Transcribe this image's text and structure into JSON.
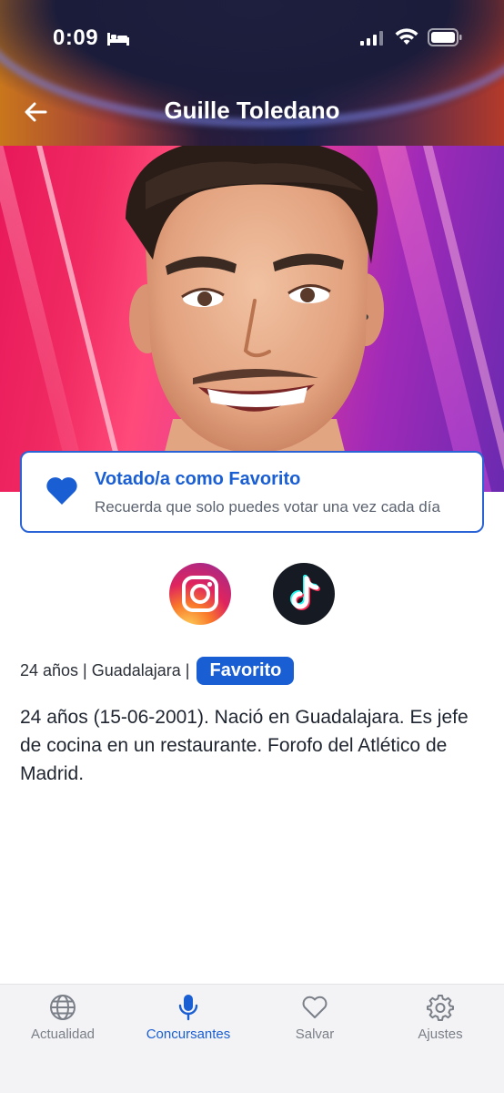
{
  "status_bar": {
    "time": "0:09",
    "icons": [
      "bed-icon",
      "signal-icon",
      "wifi-icon",
      "battery-icon"
    ]
  },
  "header": {
    "title": "Guille Toledano",
    "back_icon": "back-arrow-icon"
  },
  "vote_card": {
    "title": "Votado/a como Favorito",
    "subtitle": "Recuerda que solo puedes votar una vez cada día",
    "icon": "heart-fill-icon"
  },
  "social": {
    "links": [
      "instagram",
      "tiktok"
    ]
  },
  "info": {
    "text": "24 años | Guadalajara |",
    "badge": "Favorito"
  },
  "bio": "24 años (15-06-2001). Nació en Guadalajara. Es jefe de cocina en un restaurante. Forofo del Atlético de Madrid.",
  "tabs": [
    {
      "label": "Actualidad",
      "icon": "globe-icon",
      "active": false
    },
    {
      "label": "Concursantes",
      "icon": "microphone-icon",
      "active": true
    },
    {
      "label": "Salvar",
      "icon": "heart-outline-icon",
      "active": false
    },
    {
      "label": "Ajustes",
      "icon": "gear-icon",
      "active": false
    }
  ],
  "colors": {
    "accent": "#1a5ed4",
    "inactive_tab": "#7a7f88",
    "tabbar_bg": "#f3f3f5"
  }
}
